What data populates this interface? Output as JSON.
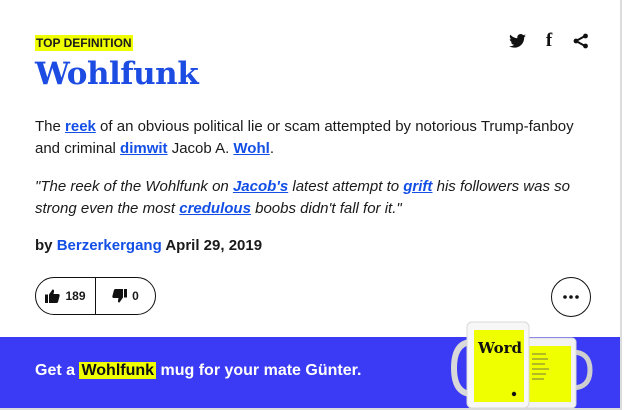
{
  "badge": "TOP DEFINITION",
  "share": {
    "icons": [
      "twitter-icon",
      "facebook-icon",
      "share-icon"
    ],
    "facebook_glyph": "f"
  },
  "word": "Wohlfunk",
  "meaning": {
    "t1": "The ",
    "l1": "reek",
    "t2": " of an obvious political lie or scam attempted by notorious Trump-fanboy and criminal ",
    "l2": "dimwit",
    "t3": " Jacob A. ",
    "l3": "Wohl",
    "t4": "."
  },
  "example": {
    "t1": "\"The reek of the Wohlfunk on ",
    "l1": "Jacob's",
    "t2": " latest attempt to ",
    "l2": "grift",
    "t3": " his followers was so strong even the most ",
    "l3": "credulous",
    "t4": " boobs didn't fall for it.\""
  },
  "byline": {
    "prefix": "by ",
    "author": "Berzerkergang",
    "date": " April 29, 2019"
  },
  "votes": {
    "up": "189",
    "down": "0"
  },
  "promo": {
    "pre": "Get a ",
    "word": "Wohlfunk",
    "post": " mug for your mate Günter."
  },
  "mug": {
    "label": "Word"
  },
  "colors": {
    "accent": "#1d4ce2",
    "link": "#134fe6",
    "badge": "#efff00",
    "promo_bg": "#3b3bf5"
  }
}
